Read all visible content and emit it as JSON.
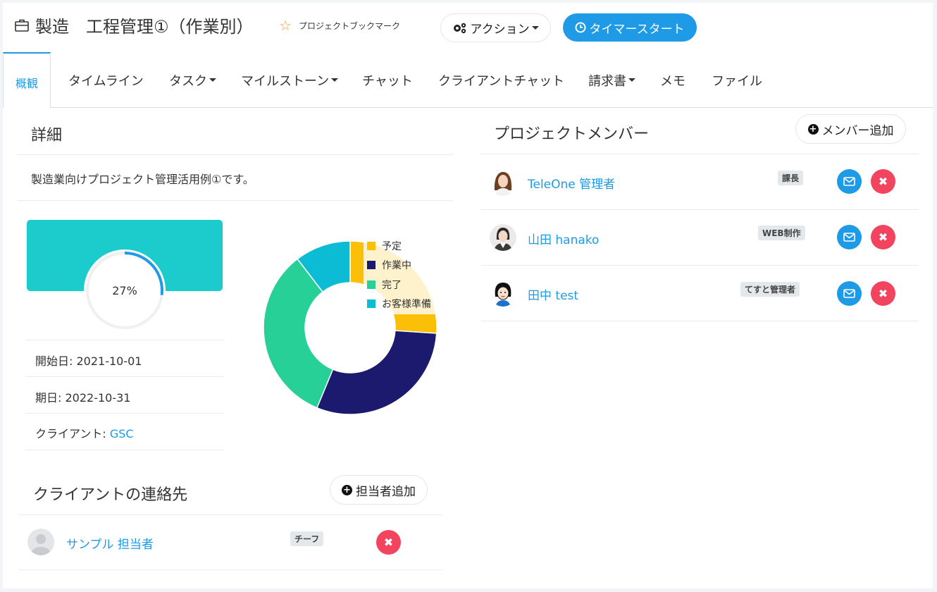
{
  "project": {
    "title": "製造　工程管理①（作業別）",
    "bookmark_label": "プロジェクトブックマーク",
    "action_label": "アクション",
    "timer_label": "タイマースタート"
  },
  "tabs": [
    {
      "label": "概観",
      "active": true
    },
    {
      "label": "タイムライン"
    },
    {
      "label": "タスク",
      "dropdown": true
    },
    {
      "label": "マイルストーン",
      "dropdown": true
    },
    {
      "label": "チャット"
    },
    {
      "label": "クライアントチャット"
    },
    {
      "label": "請求書",
      "dropdown": true
    },
    {
      "label": "メモ"
    },
    {
      "label": "ファイル"
    }
  ],
  "details": {
    "heading": "詳細",
    "description": "製造業向けプロジェクト管理活用例①です。",
    "progress": 27,
    "progress_label": "27%",
    "start_date": "開始日: 2021-10-01",
    "due_date": "期日: 2022-10-31",
    "client_label": "クライアント: ",
    "client_name": "GSC"
  },
  "chart_data": {
    "type": "pie",
    "variant": "donut",
    "categories": [
      "予定",
      "作業中",
      "完了",
      "お客様準備"
    ],
    "values": [
      25,
      29,
      32,
      10
    ],
    "colors": [
      "#fbbf08",
      "#1b1a6e",
      "#27d096",
      "#0bbcd4"
    ],
    "legend": "top-right"
  },
  "client_contacts": {
    "heading": "クライアントの連絡先",
    "add_label": "担当者追加",
    "items": [
      {
        "name": "サンプル 担当者",
        "role": "チーフ"
      }
    ]
  },
  "members": {
    "heading": "プロジェクトメンバー",
    "add_label": "メンバー追加",
    "items": [
      {
        "name": "TeleOne 管理者",
        "role": "課長"
      },
      {
        "name": "山田 hanako",
        "role": "WEB制作"
      },
      {
        "name": "田中 test",
        "role": "てすと管理者"
      }
    ]
  },
  "colors": {
    "accent": "#1e9ae6",
    "danger": "#f2445e",
    "progress_card": "#1ccbcb"
  }
}
